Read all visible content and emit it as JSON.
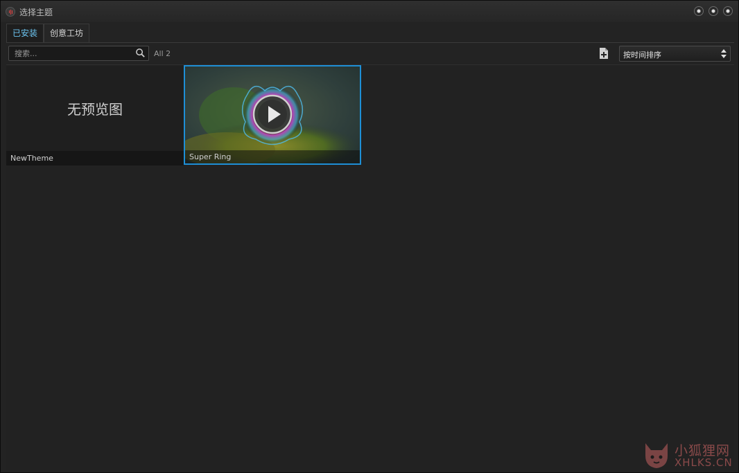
{
  "window": {
    "title": "选择主题"
  },
  "tabs": [
    {
      "label": "已安装",
      "active": true
    },
    {
      "label": "创意工坊",
      "active": false
    }
  ],
  "toolbar": {
    "search_placeholder": "搜索...",
    "count_label": "All 2",
    "sort_value": "按时间排序"
  },
  "themes": [
    {
      "name": "NewTheme",
      "preview_text": "无预览图",
      "selected": false
    },
    {
      "name": "Super Ring",
      "selected": true
    }
  ],
  "watermark": {
    "cn": "小狐狸网",
    "en": "XHLKS.CN"
  },
  "colors": {
    "accent": "#1e8fd6",
    "active_tab_text": "#6cc4f0",
    "background": "#222222"
  }
}
